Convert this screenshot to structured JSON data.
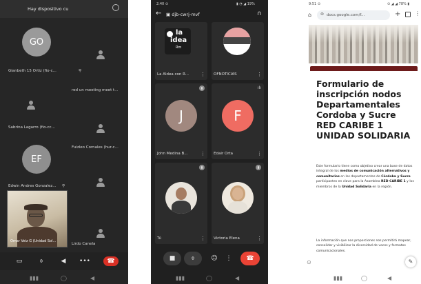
{
  "phone_meet_list": {
    "header_title": "Hay dispositivo cu",
    "participants": [
      {
        "initials": "GO",
        "name": "Gianbeth 15 Ortiz (fio-c...",
        "avatar_color": "#9a9a9a"
      },
      {
        "name": "red un meeting meet t...",
        "icon": "person-icon"
      },
      {
        "name": "Sabrina Lagarro (fio-cc...",
        "icon": "person-icon"
      },
      {
        "name": "Fuizleo Cornales (hur-c...",
        "icon": "person-icon"
      },
      {
        "initials": "EF",
        "name": "Edwin Andres Gonzalez...",
        "avatar_color": "#8f8f8f"
      },
      {
        "name": "Omar Veiz G (Unidad Sol...",
        "is_self_view": true
      },
      {
        "name": "Lirdo Canela",
        "icon": "person-icon"
      }
    ],
    "controls": [
      "camera-off-icon",
      "mic-off-icon",
      "speaker-icon",
      "more-icon",
      "end-call-icon"
    ],
    "end_call_color": "#d93025",
    "nav": [
      "recent-apps-icon",
      "home-icon",
      "back-icon"
    ]
  },
  "phone_meet_grid": {
    "status_time": "2:40 ⊙",
    "status_right": "▮ ◔ ◢ 19%",
    "meeting_code": "▣ djb-cwrj-mvf",
    "tiles": [
      {
        "name": "La Aldea con R...",
        "type": "logo",
        "logo_text_1": "la",
        "logo_text_2": "idea",
        "logo_text_3": "Rm"
      },
      {
        "name": "OFNOTICIAS",
        "type": "banner"
      },
      {
        "name": "John Medina B...",
        "initial": "J",
        "color": "#a1887f"
      },
      {
        "name": "Edair Orta",
        "initial": "F",
        "color": "#ef6c62"
      },
      {
        "name": "Tú",
        "type": "photo"
      },
      {
        "name": "Victoria Elena",
        "type": "photo"
      }
    ],
    "controls": [
      "camera-icon",
      "mic-icon",
      "emoji-icon",
      "more-icon",
      "end-call-icon"
    ],
    "end_call_color": "#ea4335",
    "nav": [
      "recent-apps-icon",
      "home-icon",
      "back-icon"
    ]
  },
  "phone_form": {
    "status_time": "9:51 ⊙",
    "status_right": "⊙ ◢ ◢ 78% ▮",
    "url": "docs.google.com/f...",
    "headline": "Formulario de inscripción nodos Departamentales Cordoba y Sucre RED CARIBE 1 UNIDAD SOLIDARIA",
    "para1": [
      {
        "text": "Este formulario tiene como objetivo crear una base de datos integral de los "
      },
      {
        "text": "medios de comunicación alternativos y comunitarios",
        "bold": true
      },
      {
        "text": " en los departamentos de "
      },
      {
        "text": "Córdoba y Sucre",
        "bold": true
      },
      {
        "text": " participantes en clave para la Asamblea "
      },
      {
        "text": "RED CARIBE 1",
        "bold": true
      },
      {
        "text": " y los miembros de la "
      },
      {
        "text": "Unidad Solidaria",
        "bold": true
      },
      {
        "text": " en la región."
      }
    ],
    "para2": "La información que nos proporciones nos permitirá mapear, consolidar y visibilizar la diversidad de voces y formatos comunicacionales.",
    "accent_color": "#6d1b1b",
    "nav": [
      "recent-apps-icon",
      "home-icon",
      "back-icon"
    ]
  }
}
